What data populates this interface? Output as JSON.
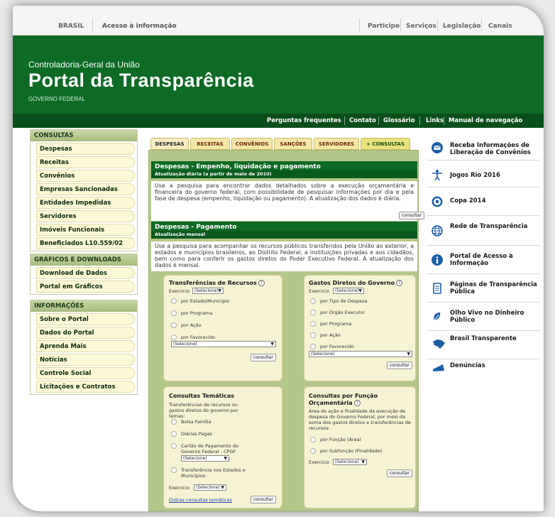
{
  "govbar": {
    "brasil": "BRASIL",
    "acesso": "Acesso à informação",
    "links": [
      "Participe",
      "Serviços",
      "Legislação",
      "Canais"
    ]
  },
  "header": {
    "org": "Controladoria-Geral da União",
    "title": "Portal da Transparência",
    "gov": "GOVERNO FEDERAL"
  },
  "navbar": [
    "Perguntas frequentes",
    "Contato",
    "Glossário",
    "Links",
    "Manual de navegação"
  ],
  "left_menu": {
    "consultas": {
      "title": "CONSULTAS",
      "items": [
        "Despesas",
        "Receitas",
        "Convênios",
        "Empresas Sancionadas",
        "Entidades Impedidas",
        "Servidores",
        "Imóveis Funcionais",
        "Beneficiados L10.559/02"
      ]
    },
    "graficos": {
      "title": "GRÁFICOS E DOWNLOADS",
      "items": [
        "Download de Dados",
        "Portal em Gráficos"
      ]
    },
    "informacoes": {
      "title": "INFORMAÇÕES",
      "items": [
        "Sobre o Portal",
        "Dados do Portal",
        "Aprenda Mais",
        "Notícias",
        "Controle Social",
        "Licitações e Contratos"
      ]
    }
  },
  "tabs": [
    "DESPESAS",
    "RECEITAS",
    "CONVÊNIOS",
    "SANÇÕES",
    "SERVIDORES",
    "+ CONSULTAS"
  ],
  "sec1": {
    "title": "Despesas - Empenho, liquidação e pagamento",
    "subtitle": "Atualização diária (a partir de maio de 2010)",
    "body": "Use a pesquisa para encontrar dados detalhados sobre a execução orçamentária e financeira do governo federal, com possibilidade de pesquisar informações por dia e pela fase de despesa (empenho, liquidação ou pagamento). A atualização dos dados é diária.",
    "button": "consultar"
  },
  "sec2": {
    "title": "Despesas - Pagamento",
    "subtitle": "Atualização mensal",
    "body": "Use a pesquisa para acompanhar os recursos públicos transferidos pela União ao exterior, a estados e municípios brasileiros, ao Distrito Federal, a instituições privadas e aos cidadãos, bem como para conferir os gastos diretos do Poder Executivo Federal. A atualização dos dados é mensal."
  },
  "transf": {
    "title": "Transferências de Recursos",
    "exercicio_label": "Exercício",
    "exercicio_value": "(Selecione)",
    "options": [
      "por Estado/Município",
      "por Programa",
      "por Ação",
      "por Favorecido"
    ],
    "select_value": "(Selecione)",
    "button": "consultar"
  },
  "gastos": {
    "title": "Gastos Diretos do Governo",
    "exercicio_label": "Exercício",
    "exercicio_value": "(Selecione)",
    "options": [
      "por Tipo de Despesa",
      "por Órgão Executor",
      "por Programa",
      "por Ação",
      "por Favorecido"
    ],
    "select_value": "(Selecione)",
    "button": "consultar"
  },
  "tematicas": {
    "title": "Consultas Temáticas",
    "desc": "Transferências de recursos ou gastos diretos do governo por temas:",
    "options": [
      "Bolsa Família",
      "Diárias Pagas",
      "Cartão de Pagamento do Governo Federal - CPGF",
      "Transferência nos Estados e Municípios"
    ],
    "cpgf_select": "(Selecione)",
    "exercicio_label": "Exercício",
    "exercicio_value": "(Selecione)",
    "link": "Outras consultas temáticas",
    "button": "consultar"
  },
  "funcao": {
    "title": "Consultas por Função Orçamentária",
    "desc": "Área de ação e finalidade da execução de despesa do Governo Federal, por meio da soma dos gastos diretos e transferências de recursos:",
    "options": [
      "por Função (Área)",
      "por Subfunção (Finalidade)"
    ],
    "exercicio_label": "Exercício",
    "exercicio_value": "(Selecione)",
    "button": "consultar"
  },
  "right": [
    {
      "label": "Receba Informações de Liberação de Convênios",
      "icon": "envelope-icon"
    },
    {
      "label": "Jogos Rio 2016",
      "icon": "olympic-figure-icon"
    },
    {
      "label": "Copa 2014",
      "icon": "soccer-ball-icon"
    },
    {
      "label": "Rede de Transparência",
      "icon": "globe-icon"
    },
    {
      "label": "Portal de Acesso à Informação",
      "icon": "info-icon"
    },
    {
      "label": "Páginas de Transparência Pública",
      "icon": "document-icon"
    },
    {
      "label": "Olho Vivo no Dinheiro Público",
      "icon": "leaf-icon"
    },
    {
      "label": "Brasil Transparente",
      "icon": "brazil-map-icon"
    },
    {
      "label": "Denúncias",
      "icon": "megaphone-icon"
    }
  ],
  "colors": {
    "green": "#0d6b24",
    "dark_green": "#0a4e1a",
    "menu_yellow": "#fbf8d6",
    "content_bg": "#b4c78a"
  }
}
